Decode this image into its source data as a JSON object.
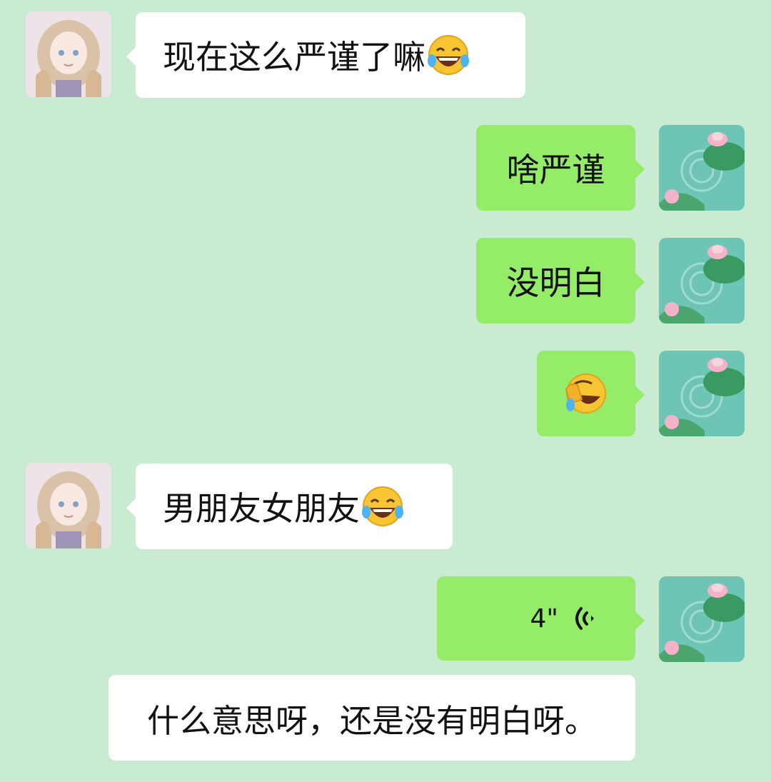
{
  "messages": [
    {
      "sender": "friend",
      "text": "现在这么严谨了嘛",
      "emoji": "tears-of-joy-emoji"
    },
    {
      "sender": "me",
      "text": "啥严谨"
    },
    {
      "sender": "me",
      "text": "没明白"
    },
    {
      "sender": "me",
      "text": "",
      "emoji": "rolling-laughing-emoji"
    },
    {
      "sender": "friend",
      "text": "男朋友女朋友",
      "emoji": "tears-of-joy-emoji"
    },
    {
      "sender": "me",
      "type": "voice",
      "duration": "4\""
    },
    {
      "sender": "overlay",
      "text": "什么意思呀，还是没有明白呀。"
    }
  ],
  "colors": {
    "background": "#c8ebd1",
    "incoming_bubble": "#ffffff",
    "outgoing_bubble": "#95ec69",
    "text": "#111111"
  }
}
